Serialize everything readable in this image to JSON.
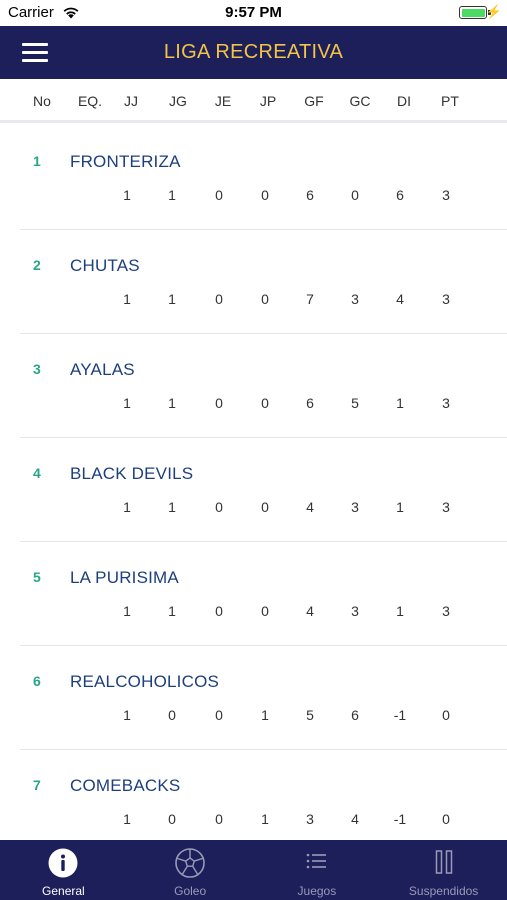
{
  "status_bar": {
    "carrier": "Carrier",
    "time": "9:57 PM"
  },
  "nav": {
    "title": "LIGA RECREATIVA",
    "menu_icon": "hamburger-menu-icon"
  },
  "columns": [
    "No",
    "EQ.",
    "JJ",
    "JG",
    "JE",
    "JP",
    "GF",
    "GC",
    "DI",
    "PT"
  ],
  "teams": [
    {
      "rank": "1",
      "name": "FRONTERIZA",
      "stats": [
        "1",
        "1",
        "0",
        "0",
        "6",
        "0",
        "6",
        "3"
      ]
    },
    {
      "rank": "2",
      "name": "CHUTAS",
      "stats": [
        "1",
        "1",
        "0",
        "0",
        "7",
        "3",
        "4",
        "3"
      ]
    },
    {
      "rank": "3",
      "name": "AYALAS",
      "stats": [
        "1",
        "1",
        "0",
        "0",
        "6",
        "5",
        "1",
        "3"
      ]
    },
    {
      "rank": "4",
      "name": "BLACK DEVILS",
      "stats": [
        "1",
        "1",
        "0",
        "0",
        "4",
        "3",
        "1",
        "3"
      ]
    },
    {
      "rank": "5",
      "name": "LA PURISIMA",
      "stats": [
        "1",
        "1",
        "0",
        "0",
        "4",
        "3",
        "1",
        "3"
      ]
    },
    {
      "rank": "6",
      "name": "REALCOHOLICOS",
      "stats": [
        "1",
        "0",
        "0",
        "1",
        "5",
        "6",
        "-1",
        "0"
      ]
    },
    {
      "rank": "7",
      "name": "COMEBACKS",
      "stats": [
        "1",
        "0",
        "0",
        "1",
        "3",
        "4",
        "-1",
        "0"
      ]
    }
  ],
  "tabs": [
    {
      "label": "General",
      "icon": "info-icon",
      "active": true
    },
    {
      "label": "Goleo",
      "icon": "soccer-ball-icon",
      "active": false
    },
    {
      "label": "Juegos",
      "icon": "list-icon",
      "active": false
    },
    {
      "label": "Suspendidos",
      "icon": "pause-icon",
      "active": false
    }
  ],
  "colors": {
    "nav_background": "#1c1f5a",
    "title": "#f3c445",
    "rank": "#2aa58a",
    "team_name": "#1d3f7e",
    "tab_active": "#ffffff",
    "tab_inactive": "#9a9ab8"
  }
}
